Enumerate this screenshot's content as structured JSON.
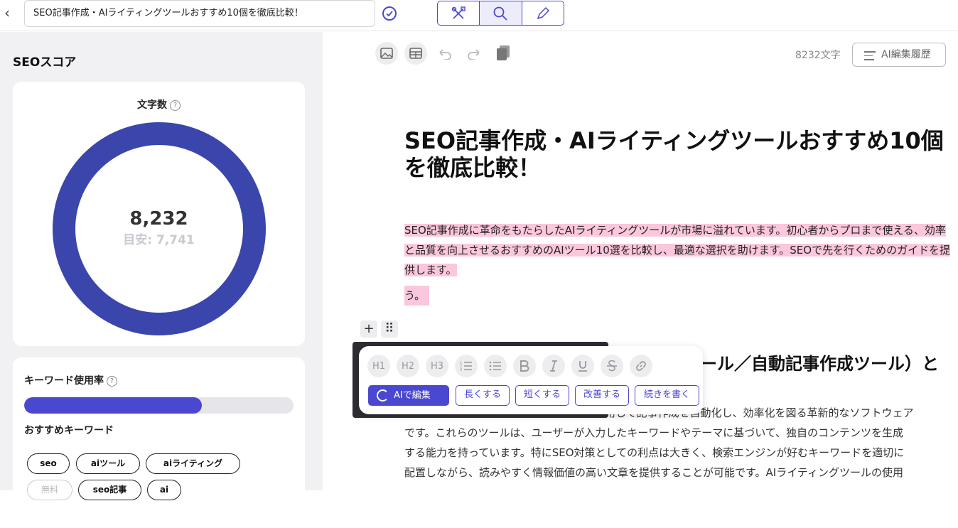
{
  "topbar": {
    "back_glyph": "‹",
    "title": "SEO記事作成・AIライティングツールおすすめ10個を徹底比較！",
    "tools": [
      "tools-icon",
      "search-icon",
      "pencil-icon"
    ]
  },
  "sidebar": {
    "heading": "SEOスコア",
    "char_card": {
      "label": "文字数",
      "value": "8,232",
      "target": "目安: 7,741",
      "progress": 1.0
    },
    "keyword_card": {
      "label": "キーワード使用率",
      "usage_fraction": 0.66,
      "recommended_label": "おすすめキーワード",
      "chips": [
        "seo",
        "aiツール",
        "aiライティング",
        "無料",
        "seo記事",
        "ai"
      ]
    }
  },
  "editor": {
    "char_count": "8232文字",
    "history_label": "AI編集履歴",
    "title": "SEO記事作成・AIライティングツールおすすめ10個を徹底比較！",
    "highlight": "SEO記事作成に革命をもたらしたAIライティングツールが市場に溢れています。初心者からプロまで使える、効率と品質を向上させるおすすめのAIツール10選を比較し、最適な選択を助けます。SEOで先を行くためのガイドを提供します。",
    "highlight2": "う。",
    "heading2_fragment": "ール／自動記事作成ツール）と",
    "para_fragment1": "用して記事作成を自動化し、効率化を図る革新的なソフトウェア",
    "para_lines": [
      "です。これらのツールは、ユーザーが入力したキーワードやテーマに基づいて、独自のコンテンツを生成",
      "する能力を持っています。特にSEO対策としての利点は大きく、検索エンジンが好むキーワードを適切に",
      "配置しながら、読みやすく情報価値の高い文章を提供することが可能です。AIライティングツールの使用"
    ],
    "block_add": "+",
    "block_drag": "⠿"
  },
  "popup": {
    "formats": [
      "H1",
      "H2",
      "H3"
    ],
    "ai_edit": "AIで編集",
    "actions": [
      "長くする",
      "短くする",
      "改善する",
      "続きを書く"
    ]
  },
  "colors": {
    "accent": "#4a48d0",
    "donut": "#3a46ac",
    "highlight": "#fbc7dc"
  }
}
